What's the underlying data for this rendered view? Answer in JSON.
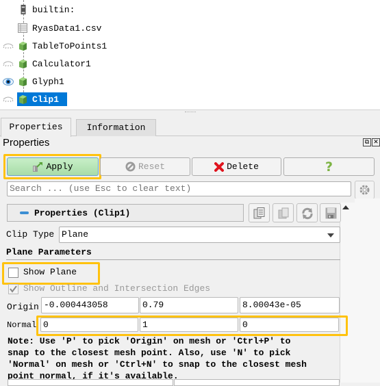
{
  "pipeline": {
    "items": [
      {
        "label": "builtin:",
        "icon": "server-icon",
        "visibility": "none"
      },
      {
        "label": "RyasData1.csv",
        "icon": "table-icon",
        "visibility": "none"
      },
      {
        "label": "TableToPoints1",
        "icon": "cube-icon",
        "visibility": "hidden"
      },
      {
        "label": "Calculator1",
        "icon": "cube-icon",
        "visibility": "hidden"
      },
      {
        "label": "Glyph1",
        "icon": "cube-icon",
        "visibility": "visible"
      },
      {
        "label": "Clip1",
        "icon": "cube-icon",
        "visibility": "hidden",
        "selected": true
      }
    ]
  },
  "tabs": [
    {
      "label": "Properties",
      "active": true
    },
    {
      "label": "Information",
      "active": false
    }
  ],
  "panel": {
    "title": "Properties",
    "buttons": {
      "apply": "Apply",
      "reset": "Reset",
      "delete": "Delete",
      "help": "?"
    },
    "search_placeholder": "Search ... (use Esc to clear text)",
    "section_title": "Properties (Clip1)",
    "clip_type_label": "Clip Type",
    "clip_type_value": "Plane",
    "plane_parameters_title": "Plane Parameters",
    "show_plane_label": "Show Plane",
    "show_plane_checked": false,
    "show_outline_label": "Show Outline and Intersection Edges",
    "show_outline_checked": true,
    "origin_label": "Origin",
    "origin": [
      "-0.000443058",
      "0.79",
      "8.00043e-05"
    ],
    "normal_label": "Normal",
    "normal": [
      "0",
      "1",
      "0"
    ],
    "note": "Note: Use 'P' to pick 'Origin' on mesh or 'Ctrl+P' to\nsnap to the closest mesh point. Also, use 'N' to pick\n'Normal' on mesh or 'Ctrl+N' to snap to the closest mesh\npoint normal, if it's available."
  },
  "colors": {
    "selection": "#0078d7",
    "highlight": "#ffc20e",
    "apply_green": "#b8e6b8"
  }
}
